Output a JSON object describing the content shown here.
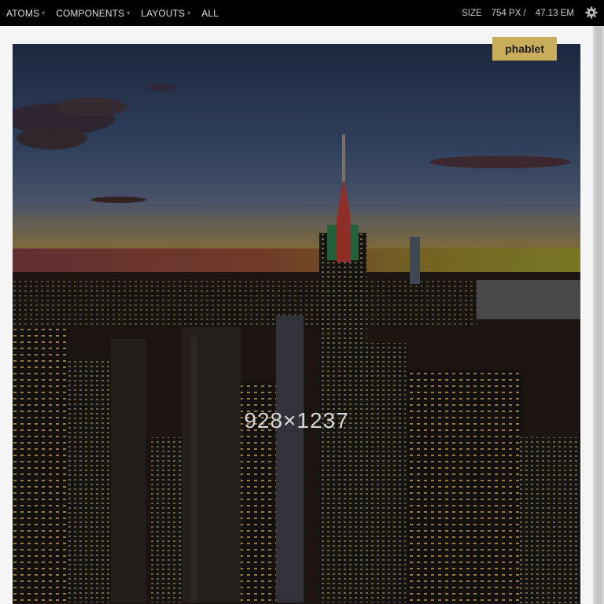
{
  "nav": {
    "items": [
      {
        "label": "ATOMS",
        "has_caret": true
      },
      {
        "label": "COMPONENTS",
        "has_caret": true
      },
      {
        "label": "LAYOUTS",
        "has_caret": true
      },
      {
        "label": "ALL",
        "has_caret": false
      }
    ],
    "caret_glyph": "▾"
  },
  "size": {
    "label": "SIZE",
    "px": "754 PX /",
    "em": "47.13 EM"
  },
  "settings_icon": "gear-icon",
  "viewport": {
    "badge": "phablet",
    "image_dimensions": "928×1237",
    "image_subject": "city-skyline-night-photo"
  },
  "colors": {
    "topbar": "#000000",
    "badge": "#c9ad5b"
  }
}
